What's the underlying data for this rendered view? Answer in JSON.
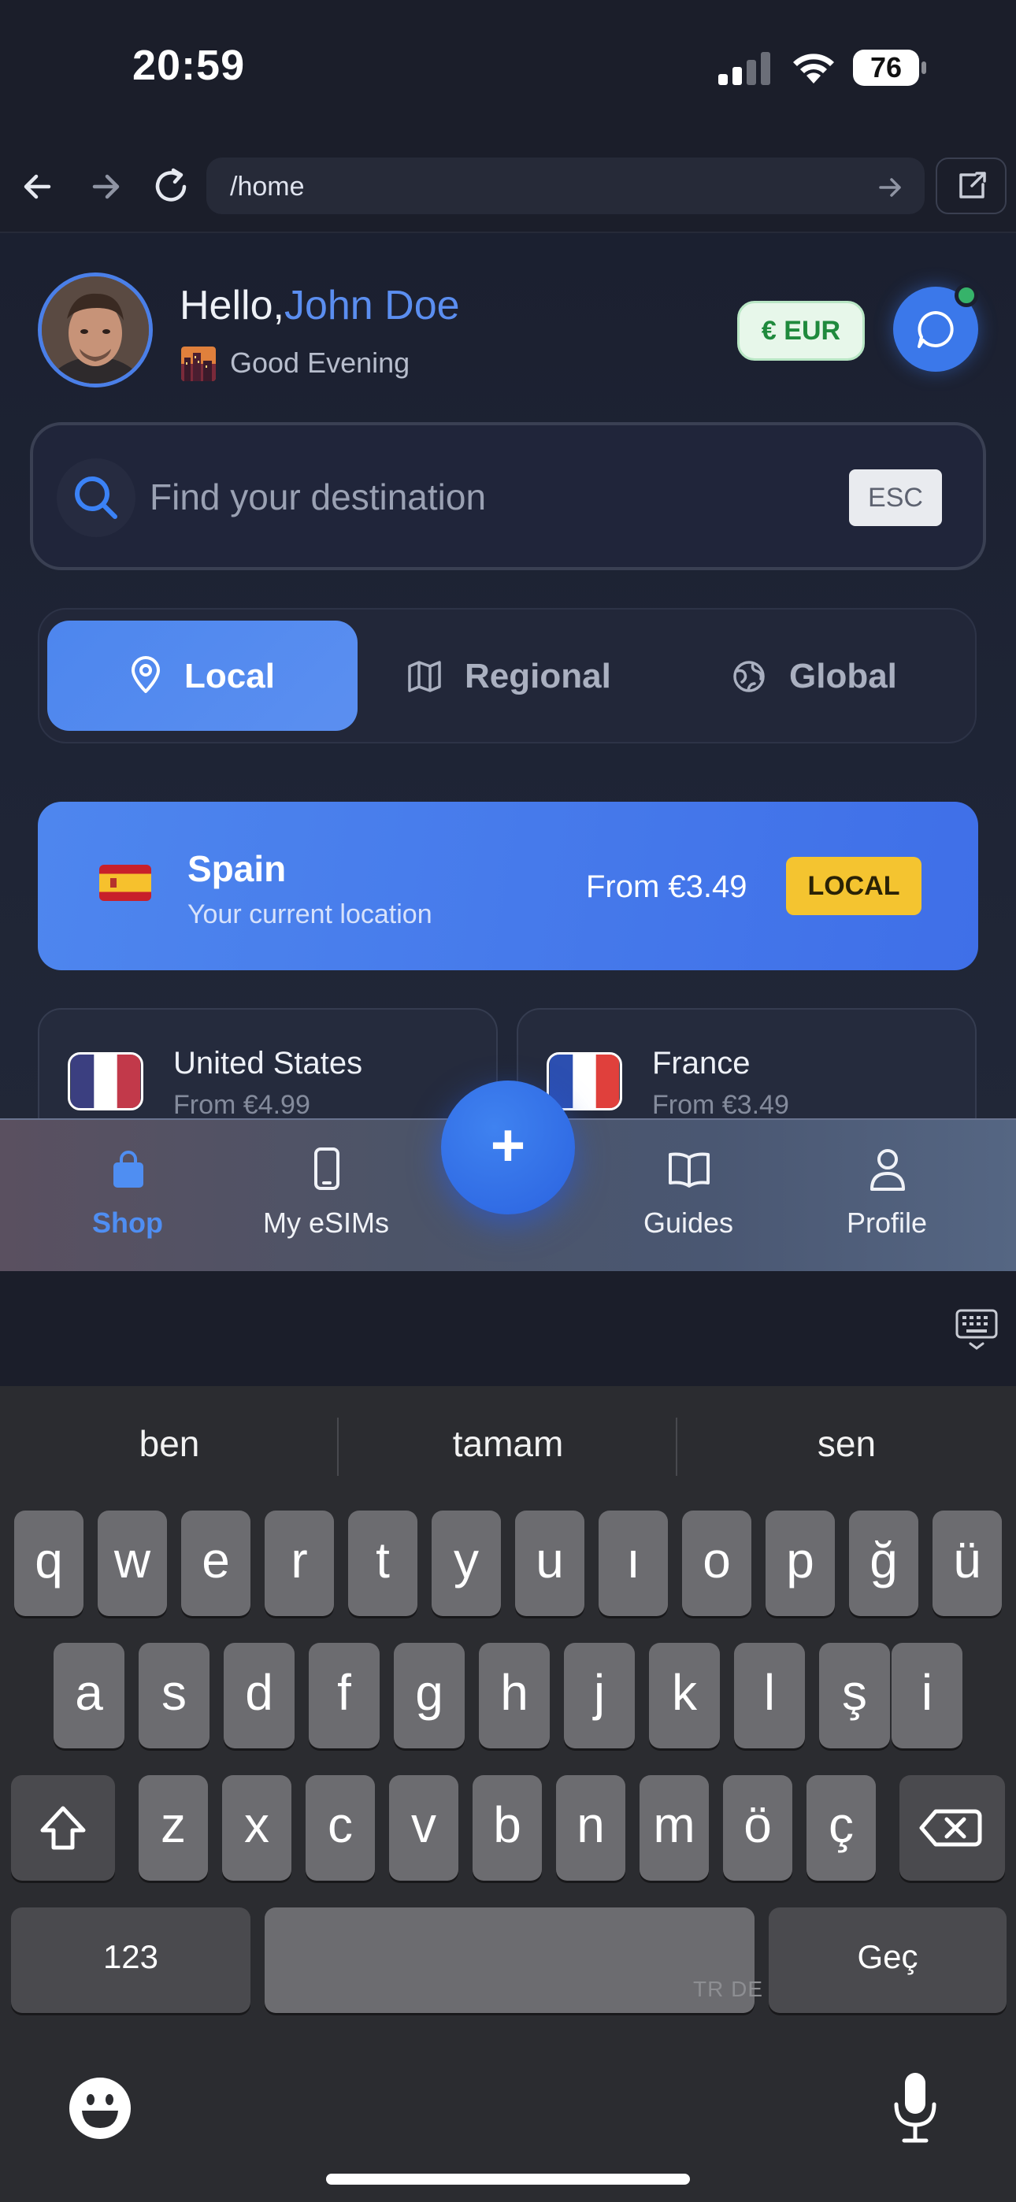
{
  "status": {
    "time": "20:59",
    "battery": "76"
  },
  "browser": {
    "url": "/home"
  },
  "header": {
    "hello": "Hello,",
    "name": "John Doe",
    "greeting": "Good Evening",
    "currency": "€ EUR"
  },
  "search": {
    "placeholder": "Find your destination",
    "esc": "ESC"
  },
  "tabs": [
    {
      "label": "Local",
      "active": true
    },
    {
      "label": "Regional",
      "active": false
    },
    {
      "label": "Global",
      "active": false
    }
  ],
  "current_location": {
    "country": "Spain",
    "subtitle": "Your current location",
    "price": "From €3.49",
    "badge": "LOCAL"
  },
  "countries": [
    {
      "name": "United States",
      "price": "From €4.99"
    },
    {
      "name": "France",
      "price": "From €3.49"
    }
  ],
  "bottom_nav": [
    {
      "label": "Shop",
      "icon": "shopping-bag-icon",
      "active": true
    },
    {
      "label": "My eSIMs",
      "icon": "phone-icon",
      "active": false
    },
    {
      "label": "Guides",
      "icon": "book-icon",
      "active": false
    },
    {
      "label": "Profile",
      "icon": "user-icon",
      "active": false
    }
  ],
  "fab": {
    "symbol": "+"
  },
  "keyboard": {
    "suggestions": [
      "ben",
      "tamam",
      "sen"
    ],
    "row1": [
      "q",
      "w",
      "e",
      "r",
      "t",
      "y",
      "u",
      "ı",
      "o",
      "p",
      "ğ",
      "ü"
    ],
    "row2": [
      "a",
      "s",
      "d",
      "f",
      "g",
      "h",
      "j",
      "k",
      "l",
      "ş",
      "i"
    ],
    "row3": [
      "z",
      "x",
      "c",
      "v",
      "b",
      "n",
      "m",
      "ö",
      "ç"
    ],
    "numbers_label": "123",
    "space_hint": "TR DE",
    "return_label": "Geç"
  },
  "colors": {
    "accent": "#4f8ef2",
    "badge_yellow": "#f4c430",
    "currency_green": "#1f8a3d"
  }
}
